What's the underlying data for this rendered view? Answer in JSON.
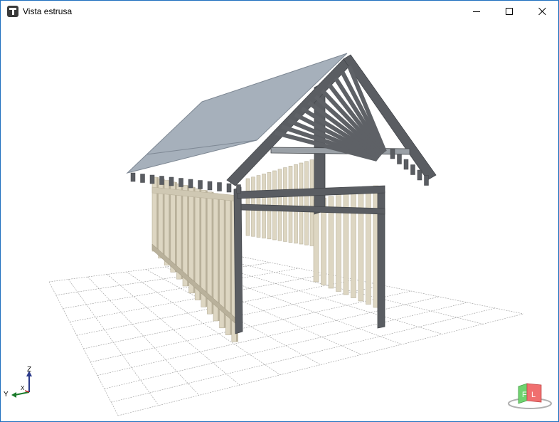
{
  "window": {
    "title": "Vista estrusa",
    "app_icon": "t-app-icon",
    "buttons": {
      "minimize": "minimize-icon",
      "maximize": "maximize-icon",
      "close": "close-icon"
    }
  },
  "scene": {
    "view": "3d-perspective",
    "colors": {
      "roof": "#a6b0bb",
      "roof_dark": "#8d97a3",
      "beam": "#5a5d62",
      "beam_dark": "#44474b",
      "stud": "#ddd6c2",
      "stud_edge": "#b9b19b",
      "grid": "#9a9a9a"
    }
  },
  "axes_gizmo": {
    "z_label": "Z",
    "y_label": "Y",
    "x_label": "X"
  },
  "view_cube": {
    "face_front": "F",
    "face_left": "L",
    "front_color": "#6fd36f",
    "left_color": "#f06f6f"
  }
}
